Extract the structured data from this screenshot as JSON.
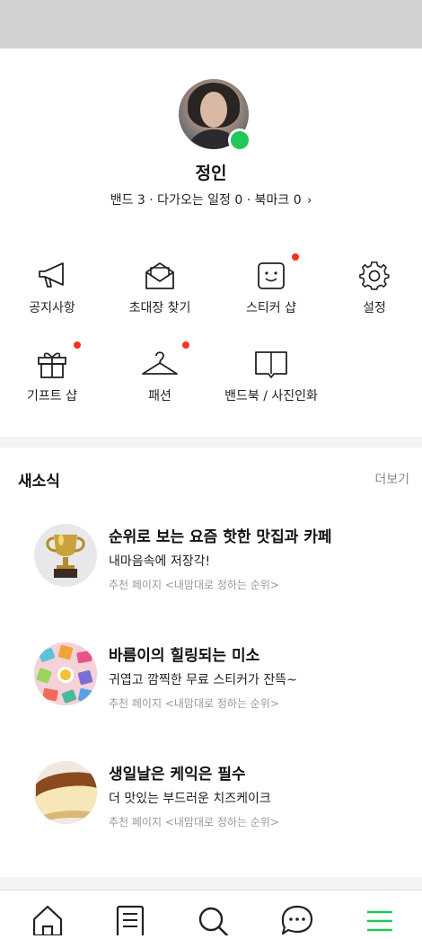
{
  "profile": {
    "name": "정인",
    "stats": "밴드 3 · 다가오는 일정 0 · 북마크 0",
    "online": true,
    "chevron": "chevron-right-icon"
  },
  "menu": {
    "items": [
      {
        "label": "공지사항",
        "icon": "megaphone-icon",
        "dot": false
      },
      {
        "label": "초대장 찾기",
        "icon": "envelope-icon",
        "dot": false
      },
      {
        "label": "스티커 샵",
        "icon": "sticker-smile-icon",
        "dot": true
      },
      {
        "label": "설정",
        "icon": "gear-icon",
        "dot": false
      },
      {
        "label": "기프트 샵",
        "icon": "gift-icon",
        "dot": true
      },
      {
        "label": "패션",
        "icon": "hanger-icon",
        "dot": true
      },
      {
        "label": "밴드북 / 사진인화",
        "icon": "book-icon",
        "dot": false
      }
    ]
  },
  "news": {
    "title": "새소식",
    "more": "더보기",
    "items": [
      {
        "title": "순위로 보는 요즘 핫한 맛집과 카페",
        "desc": "내마음속에 저장각!",
        "source": "추천 페이지 <내맘대로 정하는 순위>",
        "thumb": "trophy"
      },
      {
        "title": "바름이의 힐링되는 미소",
        "desc": "귀엽고 깜찍한 무료 스티커가 잔뜩~",
        "source": "추천 페이지 <내맘대로 정하는 순위>",
        "thumb": "stickers"
      },
      {
        "title": "생일날은 케익은 필수",
        "desc": "더 맛있는 부드러운 치즈케이크",
        "source": "추천 페이지 <내맘대로 정하는 순위>",
        "thumb": "cheesecake"
      }
    ]
  },
  "tabbar": {
    "tabs": [
      "home-icon",
      "feed-icon",
      "search-icon",
      "chat-icon",
      "menu-icon"
    ],
    "active_color": "#1fc95a"
  },
  "colors": {
    "online": "#1fc95a",
    "notification_dot": "#f5331f",
    "section_bg": "#f3f3f5"
  }
}
